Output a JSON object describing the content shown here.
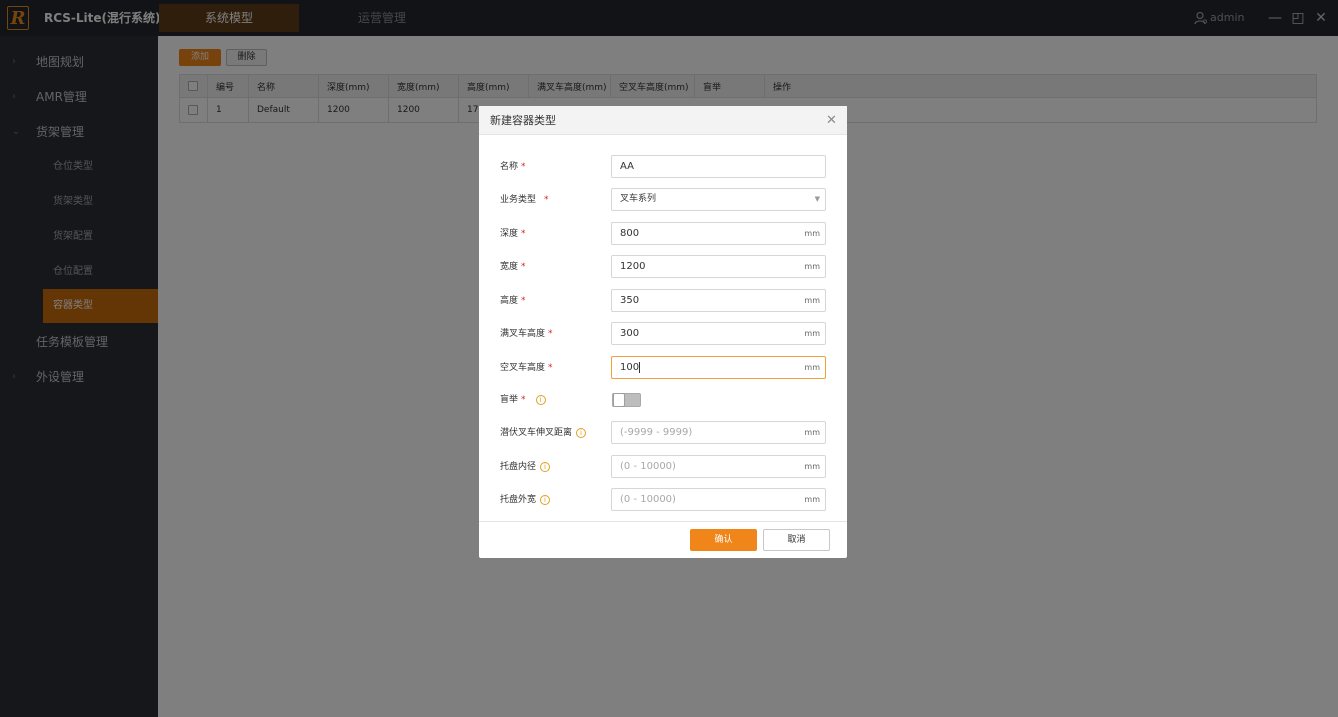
{
  "app": {
    "title": "RCS-Lite(混行系统)",
    "logo_letter": "R"
  },
  "top_tabs": [
    {
      "label": "系统模型",
      "active": true
    },
    {
      "label": "运营管理",
      "active": false
    }
  ],
  "user": {
    "name": "admin"
  },
  "window_controls": {
    "minimize": "—",
    "restore": "◰",
    "close": "✕"
  },
  "sidebar": {
    "items": [
      {
        "label": "地图规划",
        "arrow": "›"
      },
      {
        "label": "AMR管理",
        "arrow": "›"
      },
      {
        "label": "货架管理",
        "arrow": "⌄"
      },
      {
        "label": "任务模板管理",
        "arrow": ""
      },
      {
        "label": "外设管理",
        "arrow": "›"
      }
    ],
    "sub_items": [
      {
        "label": "仓位类型"
      },
      {
        "label": "货架类型"
      },
      {
        "label": "货架配置"
      },
      {
        "label": "仓位配置"
      },
      {
        "label": "容器类型",
        "active": true
      }
    ]
  },
  "toolbar": {
    "add_label": "添加",
    "delete_label": "删除"
  },
  "table": {
    "columns": [
      "编号",
      "名称",
      "深度(mm)",
      "宽度(mm)",
      "高度(mm)",
      "满叉车高度(mm)",
      "空叉车高度(mm)",
      "盲举",
      "操作"
    ],
    "rows": [
      {
        "id": "1",
        "name": "Default",
        "depth": "1200",
        "width": "1200",
        "height": "17"
      }
    ]
  },
  "modal": {
    "title": "新建容器类型",
    "close": "✕",
    "required_mark": "*",
    "info_mark": "i",
    "fields": {
      "name": {
        "label": "名称",
        "value": "AA"
      },
      "biz_type": {
        "label": "业务类型",
        "value": "叉车系列",
        "caret": "▼"
      },
      "depth": {
        "label": "深度",
        "value": "800",
        "unit": "mm"
      },
      "width": {
        "label": "宽度",
        "value": "1200",
        "unit": "mm"
      },
      "height": {
        "label": "高度",
        "value": "350",
        "unit": "mm"
      },
      "full_fork_height": {
        "label": "满叉车高度",
        "value": "300",
        "unit": "mm"
      },
      "empty_fork_height": {
        "label": "空叉车高度",
        "value": "100",
        "unit": "mm"
      },
      "blind_lift": {
        "label": "盲举",
        "on": false
      },
      "fork_extend": {
        "label": "潜伏叉车伸叉距离",
        "placeholder": "(-9999 - 9999)",
        "unit": "mm"
      },
      "pallet_inner": {
        "label": "托盘内径",
        "placeholder": "(0 - 10000)",
        "unit": "mm"
      },
      "pallet_outer": {
        "label": "托盘外宽",
        "placeholder": "(0 - 10000)",
        "unit": "mm"
      }
    },
    "ok_label": "确认",
    "cancel_label": "取消"
  },
  "colors": {
    "accent": "#f08519",
    "sidebar_bg": "#2b2e35",
    "topbar_bg": "#23262d",
    "active_tab": "#5f3c16"
  }
}
